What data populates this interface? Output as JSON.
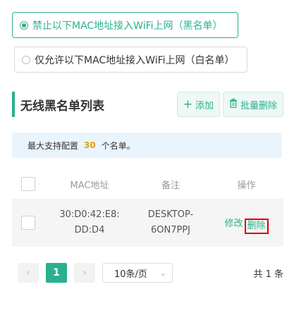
{
  "mode_options": [
    {
      "label": "禁止以下MAC地址接入WiFi上网（黑名单）",
      "selected": true
    },
    {
      "label": "仅允许以下MAC地址接入WiFi上网（白名单）",
      "selected": false
    }
  ],
  "section": {
    "title": "无线黑名单列表",
    "add_label": "添加",
    "batch_delete_label": "批量删除"
  },
  "notice": {
    "prefix": "最大支持配置",
    "max": "30",
    "suffix": "个名单。"
  },
  "table": {
    "columns": {
      "mac": "MAC地址",
      "note": "备注",
      "action": "操作"
    },
    "rows": [
      {
        "mac_line1": "30:D0:42:E8:",
        "mac_line2": "DD:D4",
        "note_line1": "DESKTOP-",
        "note_line2": "6ON7PPJ",
        "edit": "修改",
        "delete": "删除"
      }
    ]
  },
  "pagination": {
    "prev": "‹",
    "current": "1",
    "next": "›",
    "page_size": "10条/页",
    "total": "共 1 条"
  },
  "colors": {
    "accent": "#29b08f",
    "highlight_border": "#e00000",
    "notice_bg": "#eaf4fd",
    "notice_num": "#e0a100"
  }
}
